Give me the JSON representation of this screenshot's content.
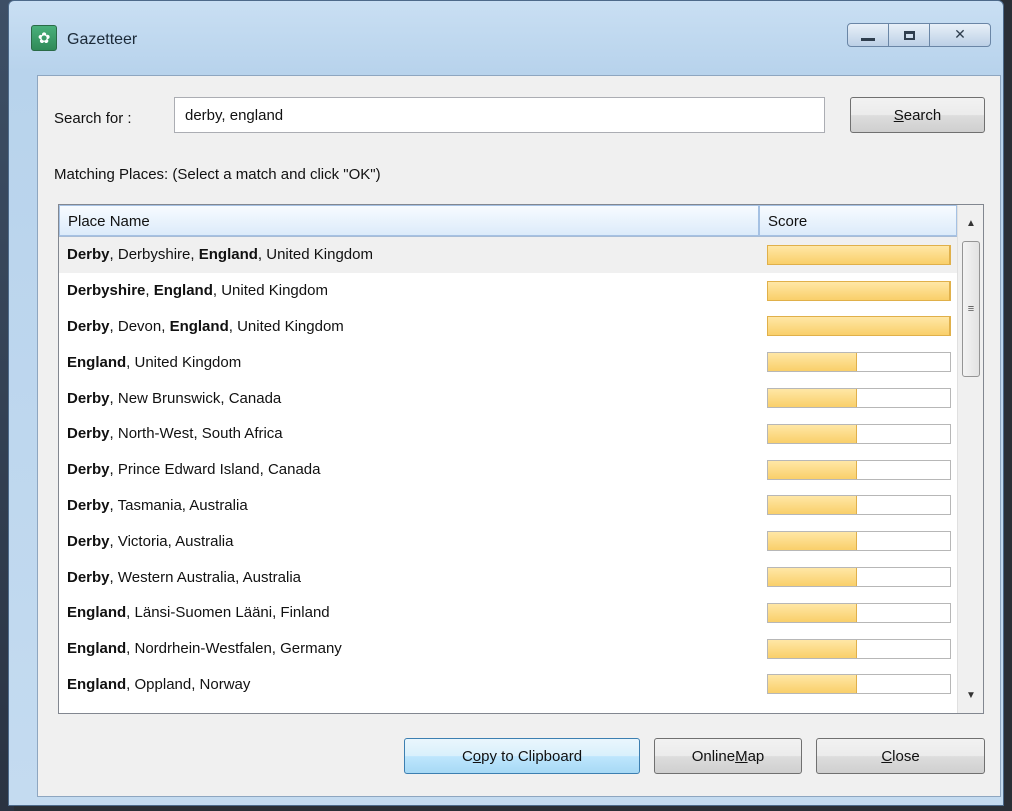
{
  "window": {
    "title": "Gazetteer",
    "app_icon": "globe-leaf-icon"
  },
  "search": {
    "label": "Search for :",
    "value": "derby, england",
    "button_label": "Search",
    "button_accel": "S",
    "button_rest": "earch"
  },
  "matching_label": "Matching Places: (Select a match and click \"OK\")",
  "table": {
    "columns": [
      "Place Name",
      "Score"
    ],
    "rows": [
      {
        "parts": [
          {
            "t": "Derby",
            "b": true
          },
          {
            "t": ", Derbyshire, "
          },
          {
            "t": "England",
            "b": true
          },
          {
            "t": ", United Kingdom"
          }
        ],
        "score": 1.0,
        "selected": true
      },
      {
        "parts": [
          {
            "t": "Derbyshire",
            "b": true
          },
          {
            "t": ", "
          },
          {
            "t": "England",
            "b": true
          },
          {
            "t": ", United Kingdom"
          }
        ],
        "score": 1.0
      },
      {
        "parts": [
          {
            "t": "Derby",
            "b": true
          },
          {
            "t": ", Devon, "
          },
          {
            "t": "England",
            "b": true
          },
          {
            "t": ", United Kingdom"
          }
        ],
        "score": 1.0
      },
      {
        "parts": [
          {
            "t": "England",
            "b": true
          },
          {
            "t": ", United Kingdom"
          }
        ],
        "score": 0.49
      },
      {
        "parts": [
          {
            "t": "Derby",
            "b": true
          },
          {
            "t": ", New Brunswick, Canada"
          }
        ],
        "score": 0.49
      },
      {
        "parts": [
          {
            "t": "Derby",
            "b": true
          },
          {
            "t": ", North-West, South Africa"
          }
        ],
        "score": 0.49
      },
      {
        "parts": [
          {
            "t": "Derby",
            "b": true
          },
          {
            "t": ", Prince Edward Island, Canada"
          }
        ],
        "score": 0.49
      },
      {
        "parts": [
          {
            "t": "Derby",
            "b": true
          },
          {
            "t": ", Tasmania, Australia"
          }
        ],
        "score": 0.49
      },
      {
        "parts": [
          {
            "t": "Derby",
            "b": true
          },
          {
            "t": ", Victoria, Australia"
          }
        ],
        "score": 0.49
      },
      {
        "parts": [
          {
            "t": "Derby",
            "b": true
          },
          {
            "t": ", Western Australia, Australia"
          }
        ],
        "score": 0.49
      },
      {
        "parts": [
          {
            "t": "England",
            "b": true
          },
          {
            "t": ", Länsi-Suomen Lääni, Finland"
          }
        ],
        "score": 0.49
      },
      {
        "parts": [
          {
            "t": "England",
            "b": true
          },
          {
            "t": ", Nordrhein-Westfalen, Germany"
          }
        ],
        "score": 0.49
      },
      {
        "parts": [
          {
            "t": "England",
            "b": true
          },
          {
            "t": ", Oppland, Norway"
          }
        ],
        "score": 0.49
      }
    ]
  },
  "buttons": {
    "copy": {
      "pre": "C",
      "accel": "o",
      "post": "py to Clipboard"
    },
    "map": {
      "pre": "Online ",
      "accel": "M",
      "post": "ap"
    },
    "close": {
      "pre": "",
      "accel": "C",
      "post": "lose"
    }
  },
  "colors": {
    "bar_fill": "#f9cf6a",
    "bar_border": "#e0b04a",
    "frame": "#b8d3ec"
  }
}
